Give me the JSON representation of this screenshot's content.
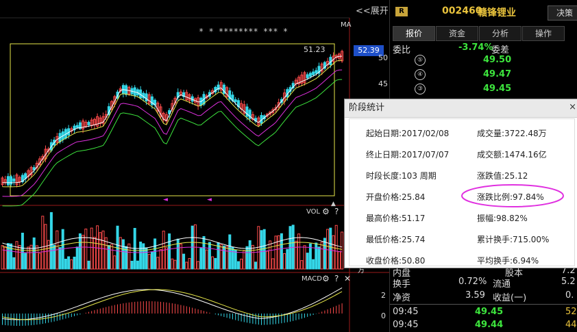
{
  "chart": {
    "expand_label": "<<展开",
    "ma_label": "MA",
    "high_label": "51.23",
    "current_price_tag": "52.39",
    "axis_ticks": [
      "50",
      "45"
    ],
    "vol_label": "VOL",
    "macd_label": "MACD",
    "vol_unit": "万",
    "macd_ticks": [
      "2",
      "0"
    ]
  },
  "quote_panel": {
    "badge": "R",
    "code": "002460",
    "name": "赣锋锂业",
    "decision_button": "决策",
    "tabs": [
      "报价",
      "资金",
      "分析",
      "操作"
    ],
    "weibi_label": "委比",
    "weibi_value": "-3.74%",
    "weicha_label": "委差",
    "sell_levels": [
      {
        "num": "⑤",
        "price": "49.50"
      },
      {
        "num": "④",
        "price": "49.47"
      },
      {
        "num": "③",
        "price": "49.45"
      }
    ],
    "lower_rows": [
      {
        "label": "内盘",
        "value": "",
        "label2": "股本",
        "value2": "7.2"
      },
      {
        "label": "换手",
        "value": "0.72%",
        "label2": "流通",
        "value2": "5.2"
      },
      {
        "label": "净资",
        "value": "3.59",
        "label2": "收益(一)",
        "value2": "0."
      }
    ],
    "ticks": [
      {
        "time": "09:45",
        "price": "49.45",
        "vol": "52"
      },
      {
        "time": "09:45",
        "price": "49.44",
        "vol": "44"
      }
    ]
  },
  "popup": {
    "title": "阶段统计",
    "close": "×",
    "left_items": [
      "起始日期:2017/02/08",
      "终止日期:2017/07/07",
      "时段长度:103 周期",
      "开盘价格:25.84",
      "最高价格:51.17",
      "最低价格:25.74",
      "收盘价格:50.80"
    ],
    "right_items": [
      "成交量:3722.48万",
      "成交额:1474.16亿",
      "涨跌值:25.12",
      "涨跌比例:97.84%",
      "振幅:98.82%",
      "累计换手:715.00%",
      "平均换手:6.94%"
    ]
  },
  "colors": {
    "up": "#ff4b4b",
    "down": "#34d7e8",
    "selection_box": "#e8e84a",
    "highlight_ellipse": "#e030e0"
  }
}
